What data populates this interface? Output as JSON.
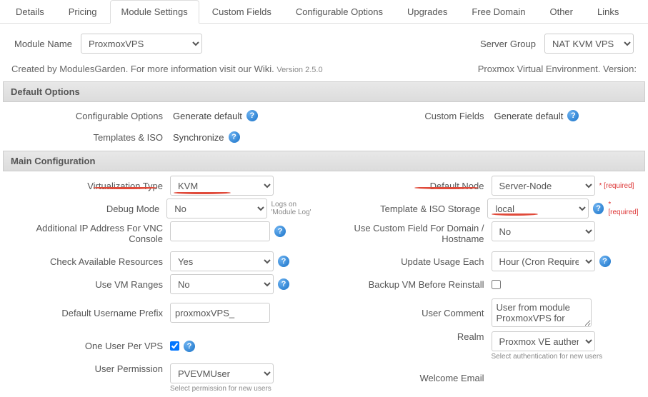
{
  "tabs": {
    "details": "Details",
    "pricing": "Pricing",
    "module_settings": "Module Settings",
    "custom_fields": "Custom Fields",
    "configurable_options": "Configurable Options",
    "upgrades": "Upgrades",
    "free_domain": "Free Domain",
    "other": "Other",
    "links": "Links"
  },
  "top": {
    "module_name_label": "Module Name",
    "module_name_value": "ProxmoxVPS",
    "server_group_label": "Server Group",
    "server_group_value": "NAT KVM VPS"
  },
  "meta": {
    "created_by": "Created by ModulesGarden. For more information visit our Wiki. ",
    "version": "Version 2.5.0",
    "pve_env": "Proxmox Virtual Environment. Version:"
  },
  "sections": {
    "default_options": "Default Options",
    "main_configuration": "Main Configuration"
  },
  "default_options": {
    "configurable_options_label": "Configurable Options",
    "configurable_options_value": "Generate default ",
    "custom_fields_label": "Custom Fields",
    "custom_fields_value": "Generate default ",
    "templates_iso_label": "Templates & ISO",
    "templates_iso_value": "Synchronize "
  },
  "main": {
    "virtualization_type_label": "Virtualization Type",
    "virtualization_type_value": "KVM",
    "default_node_label": "Default Node",
    "default_node_value": "Server-Node",
    "debug_mode_label": "Debug Mode",
    "debug_mode_value": "No",
    "debug_mode_hint": "Logs on 'Module Log'",
    "template_iso_storage_label": "Template & ISO Storage",
    "template_iso_storage_value": "local",
    "additional_ip_vnc_label": "Additional IP Address For VNC Console",
    "additional_ip_vnc_value": "",
    "use_custom_field_domain_label": "Use Custom Field For Domain / Hostname",
    "use_custom_field_domain_value": "No",
    "check_avail_label": "Check Available Resources",
    "check_avail_value": "Yes",
    "update_usage_label": "Update Usage Each",
    "update_usage_value": "Hour (Cron Required)",
    "use_vm_ranges_label": "Use VM Ranges",
    "use_vm_ranges_value": "No",
    "backup_before_reinstall_label": "Backup VM Before Reinstall",
    "backup_before_reinstall_checked": false,
    "default_username_prefix_label": "Default Username Prefix",
    "default_username_prefix_value": "proxmoxVPS_",
    "user_comment_label": "User Comment",
    "user_comment_value": "User from module ProxmoxVPS for",
    "one_user_per_vps_label": "One User Per VPS",
    "one_user_per_vps_checked": true,
    "realm_label": "Realm",
    "realm_value": "Proxmox VE authentic",
    "realm_hint": "Select authentication for new users",
    "user_permission_label": "User Permission",
    "user_permission_value": "PVEVMUser",
    "user_permission_hint": "Select permission for new users",
    "welcome_email_label": "Welcome Email",
    "required": "* [required]"
  },
  "icons": {
    "help": "?"
  }
}
